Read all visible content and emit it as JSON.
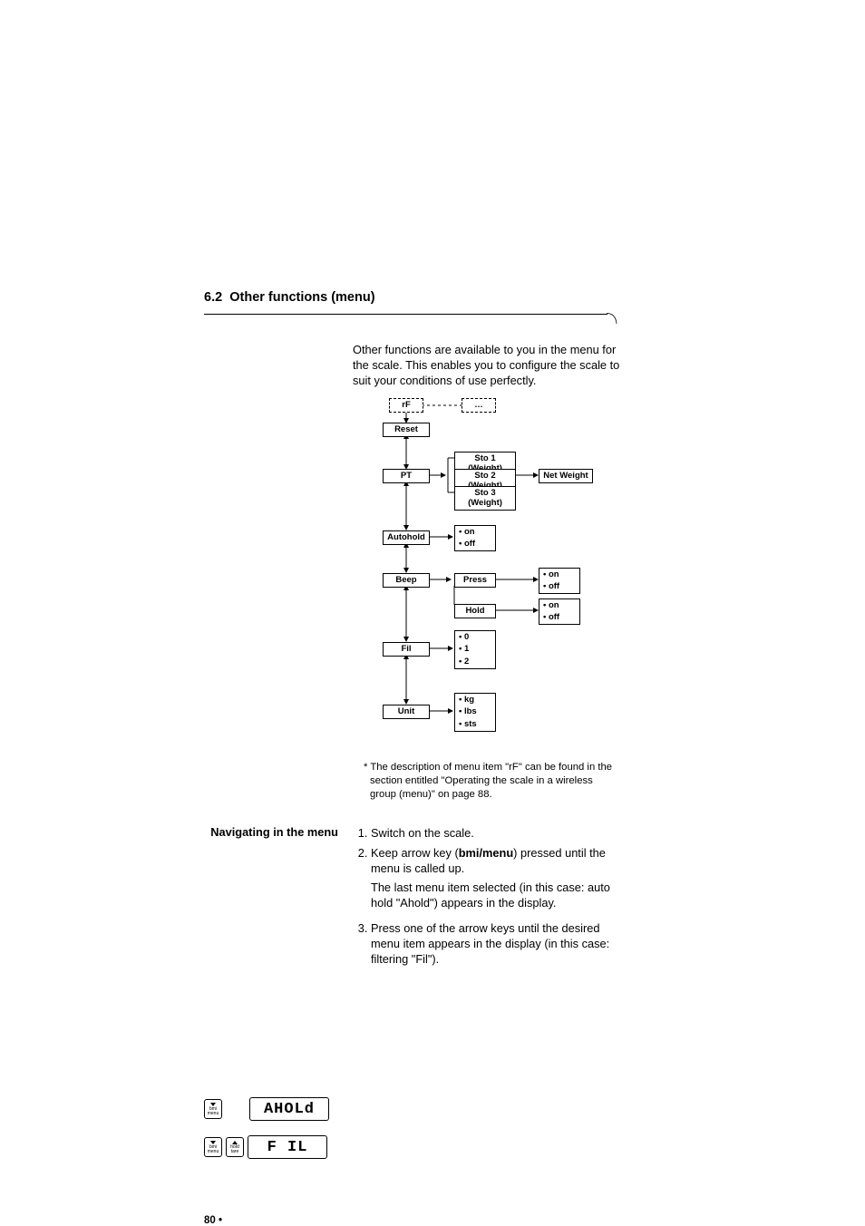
{
  "section": {
    "number": "6.2",
    "title": "Other functions (menu)"
  },
  "intro": "Other functions are available to you in the menu for the scale. This enables you to configure the scale to suit your conditions of use perfectly.",
  "diagram": {
    "rf": "rF",
    "dots": "…",
    "reset": "Reset",
    "pt": "PT",
    "sto1": "Sto 1 (Weight)",
    "sto2": "Sto 2 (Weight)",
    "sto3": "Sto 3 (Weight)",
    "netweight": "Net Weight",
    "autohold": "Autohold",
    "ah_on": "• on",
    "ah_off": "• off",
    "beep": "Beep",
    "press": "Press",
    "press_on": "• on",
    "press_off": "• off",
    "hold": "Hold",
    "hold_on": "• on",
    "hold_off": "• off",
    "fil": "Fil",
    "fil0": "• 0",
    "fil1": "• 1",
    "fil2": "• 2",
    "unit": "Unit",
    "u_kg": "• kg",
    "u_lbs": "• lbs",
    "u_sts": "• sts"
  },
  "footnote": "* The description of menu item \"rF\" can be found in the section entitled \"Operating the scale in a wireless group (menu)\" on page 88.",
  "nav": {
    "heading": "Navigating in the menu",
    "step1": "Switch on the scale.",
    "step2a": "Keep arrow key (",
    "step2b": "bmi/menu",
    "step2c": ") pressed until the menu is called up.",
    "step2_sub": "The last menu item selected (in this case: auto hold \"Ahold\") appears in the display.",
    "step3": "Press one of the arrow keys until the desired menu item appears in the display (in this case: filtering \"Fil\")."
  },
  "key": {
    "bmi": "bmi",
    "menu": "menu",
    "hold": "hold",
    "tare": "tare"
  },
  "lcd": {
    "ahold": "AHOLd",
    "fil": "F IL"
  },
  "pagenum": "80 •"
}
